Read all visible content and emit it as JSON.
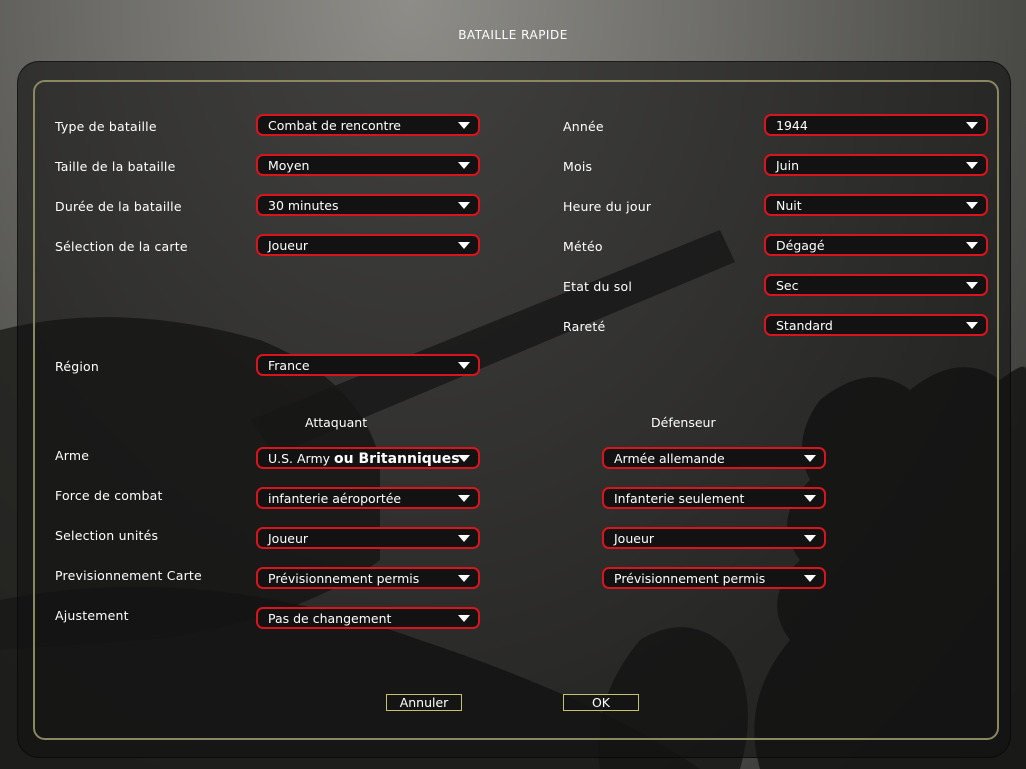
{
  "title": "BATAILLE RAPIDE",
  "colors": {
    "accent_border": "#d8141c",
    "panel_frame": "#8b8760",
    "button_border": "#c8c266"
  },
  "left_settings": [
    {
      "label": "Type de bataille",
      "value": "Combat de rencontre"
    },
    {
      "label": "Taille de la bataille",
      "value": "Moyen"
    },
    {
      "label": "Durée de la bataille",
      "value": "30 minutes"
    },
    {
      "label": "Sélection de la carte",
      "value": "Joueur"
    }
  ],
  "region": {
    "label": "Région",
    "value": "France"
  },
  "right_settings": [
    {
      "label": "Année",
      "value": "1944"
    },
    {
      "label": "Mois",
      "value": "Juin"
    },
    {
      "label": "Heure du jour",
      "value": "Nuit"
    },
    {
      "label": "Météo",
      "value": "Dégagé"
    },
    {
      "label": "Etat du sol",
      "value": "Sec"
    },
    {
      "label": "Rareté",
      "value": "Standard"
    }
  ],
  "columns": {
    "attacker": "Attaquant",
    "defender": "Défenseur"
  },
  "force_rows": [
    {
      "label": "Arme",
      "attacker_prefix": "U.S. Army",
      "attacker_suffix": "ou Britanniques",
      "defender": "Armée allemande"
    },
    {
      "label": "Force de combat",
      "attacker": "infanterie aéroportée",
      "defender": "Infanterie seulement"
    },
    {
      "label": "Selection unités",
      "attacker": "Joueur",
      "defender": "Joueur"
    },
    {
      "label": "Previsionnement Carte",
      "attacker": "Prévisionnement permis",
      "defender": "Prévisionnement permis"
    }
  ],
  "adjustment": {
    "label": "Ajustement",
    "value": "Pas de changement"
  },
  "buttons": {
    "cancel": "Annuler",
    "ok": "OK"
  }
}
